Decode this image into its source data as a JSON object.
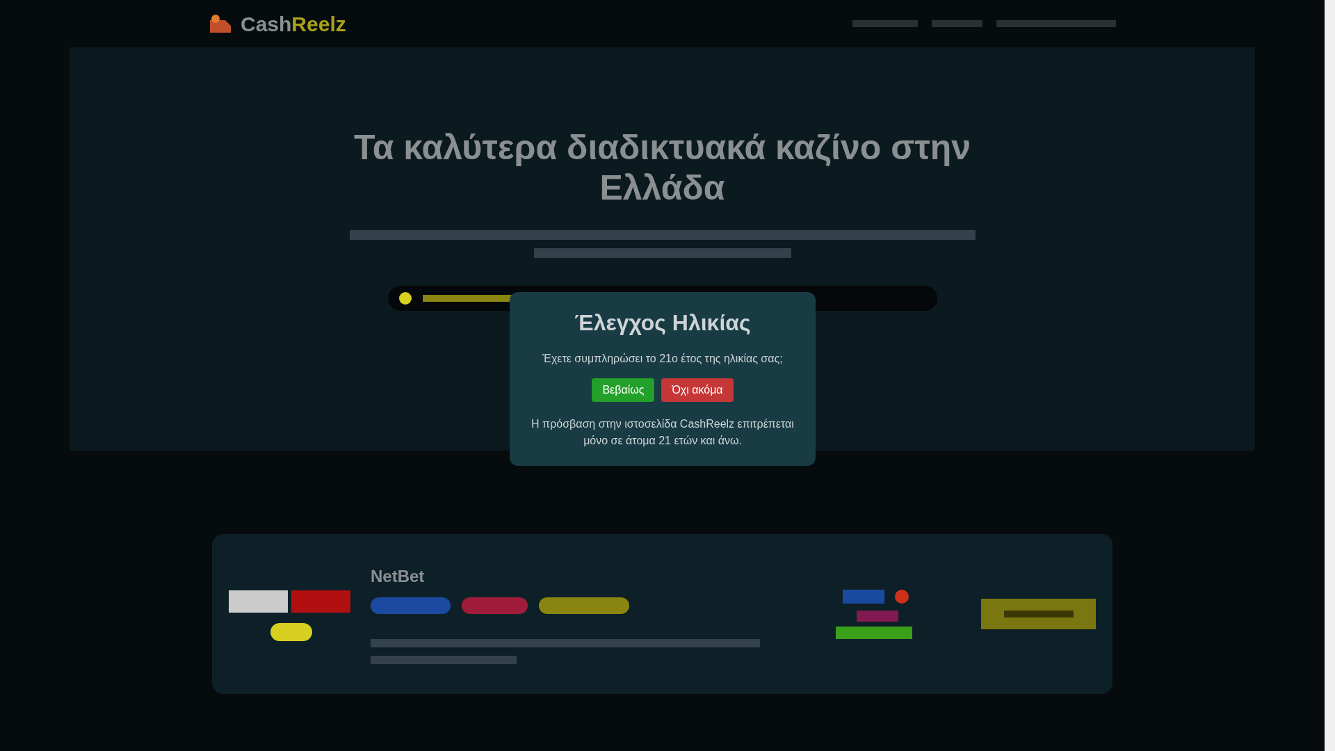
{
  "header": {
    "logo": {
      "first": "Cash",
      "second": "Reelz"
    }
  },
  "hero": {
    "title": "Τα καλύτερα διαδικτυακά καζίνο στην Ελλάδα"
  },
  "casino_card": {
    "name": "NetBet"
  },
  "age_modal": {
    "title": "Έλεγχος Ηλικίας",
    "question": "Έχετε συμπληρώσει το 21ο έτος της ηλικίας σας;",
    "buttons": [
      {
        "kind": "confirm",
        "label": "Βεβαίως"
      },
      {
        "kind": "decline",
        "label": "Όχι ακόμα"
      }
    ],
    "note": "Η πρόσβαση στην ιστοσελίδα CashReelz επιτρέπεται μόνο σε άτομα 21 ετών και άνω."
  }
}
